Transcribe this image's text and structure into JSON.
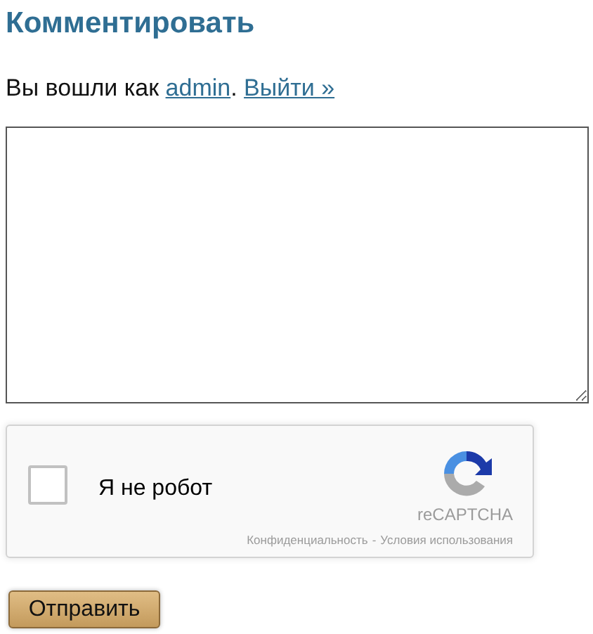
{
  "heading": "Комментировать",
  "login_line": {
    "prefix": "Вы вошли как ",
    "user_link": "admin",
    "separator": ".",
    "logout_link": "Выйти »"
  },
  "comment_field": {
    "kind": "textarea"
  },
  "captcha": {
    "checked": false,
    "label": "Я не робот",
    "brand": "reCAPTCHA",
    "privacy_link": "Конфиденциальность",
    "dash": "-",
    "terms_link": "Условия использования"
  },
  "submit_button": "Отправить"
}
